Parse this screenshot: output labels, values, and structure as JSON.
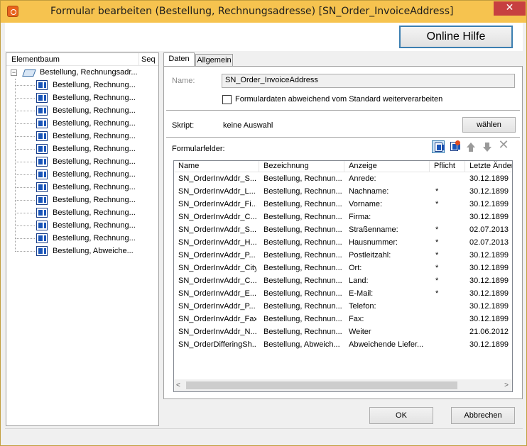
{
  "window": {
    "title": "Formular bearbeiten (Bestellung, Rechnungsadresse) [SN_Order_InvoiceAddress]",
    "close_glyph": "✕"
  },
  "header": {
    "help_label": "Online Hilfe"
  },
  "tree": {
    "col_element": "Elementbaum",
    "col_seq": "Seq",
    "expander": "−",
    "root_label": "Bestellung, Rechnungsadr...",
    "items": [
      "Bestellung, Rechnung...",
      "Bestellung, Rechnung...",
      "Bestellung, Rechnung...",
      "Bestellung, Rechnung...",
      "Bestellung, Rechnung...",
      "Bestellung, Rechnung...",
      "Bestellung, Rechnung...",
      "Bestellung, Rechnung...",
      "Bestellung, Rechnung...",
      "Bestellung, Rechnung...",
      "Bestellung, Rechnung...",
      "Bestellung, Rechnung...",
      "Bestellung, Rechnung...",
      "Bestellung, Abweiche..."
    ]
  },
  "tabs": {
    "daten": "Daten",
    "allgemein": "Allgemein"
  },
  "form": {
    "name_label": "Name:",
    "name_value": "SN_Order_InvoiceAddress",
    "checkbox_label": "Formulardaten abweichend vom Standard weiterverarbeiten",
    "skript_label": "Skript:",
    "skript_value": "keine Auswahl",
    "waehlen_label": "wählen",
    "fields_label": "Formularfelder:"
  },
  "list": {
    "headers": [
      "Name",
      "Bezeichnung",
      "Anzeige",
      "Pflicht",
      "Letzte Änder"
    ],
    "rows": [
      [
        "SN_OrderInvAddr_S...",
        "Bestellung, Rechnun...",
        "Anrede:",
        "",
        "30.12.1899"
      ],
      [
        "SN_OrderInvAddr_L...",
        "Bestellung, Rechnun...",
        "Nachname:",
        "*",
        "30.12.1899"
      ],
      [
        "SN_OrderInvAddr_Fi...",
        "Bestellung, Rechnun...",
        "Vorname:",
        "*",
        "30.12.1899"
      ],
      [
        "SN_OrderInvAddr_C...",
        "Bestellung, Rechnun...",
        "Firma:",
        "",
        "30.12.1899"
      ],
      [
        "SN_OrderInvAddr_S...",
        "Bestellung, Rechnun...",
        "Straßenname:",
        "*",
        "02.07.2013"
      ],
      [
        "SN_OrderInvAddr_H...",
        "Bestellung, Rechnun...",
        "Hausnummer:",
        "*",
        "02.07.2013"
      ],
      [
        "SN_OrderInvAddr_P...",
        "Bestellung, Rechnun...",
        "Postleitzahl:",
        "*",
        "30.12.1899"
      ],
      [
        "SN_OrderInvAddr_City",
        "Bestellung, Rechnun...",
        "Ort:",
        "*",
        "30.12.1899"
      ],
      [
        "SN_OrderInvAddr_C...",
        "Bestellung, Rechnun...",
        "Land:",
        "*",
        "30.12.1899"
      ],
      [
        "SN_OrderInvAddr_E...",
        "Bestellung, Rechnun...",
        "E-Mail:",
        "*",
        "30.12.1899"
      ],
      [
        "SN_OrderInvAddr_P...",
        "Bestellung, Rechnun...",
        "Telefon:",
        "",
        "30.12.1899"
      ],
      [
        "SN_OrderInvAddr_Fax",
        "Bestellung, Rechnun...",
        "Fax:",
        "",
        "30.12.1899"
      ],
      [
        "SN_OrderInvAddr_N...",
        "Bestellung, Rechnun...",
        "Weiter",
        "",
        "21.06.2012"
      ],
      [
        "SN_OrderDifferingSh...",
        "Bestellung, Abweich...",
        "Abweichende Liefer...",
        "",
        "30.12.1899"
      ]
    ],
    "scroll_left": "<",
    "scroll_right": ">"
  },
  "buttons": {
    "ok": "OK",
    "cancel": "Abbrechen"
  },
  "colors": {
    "titlebar": "#f6c34f",
    "close": "#c74040",
    "accent": "#3c7fb1"
  }
}
